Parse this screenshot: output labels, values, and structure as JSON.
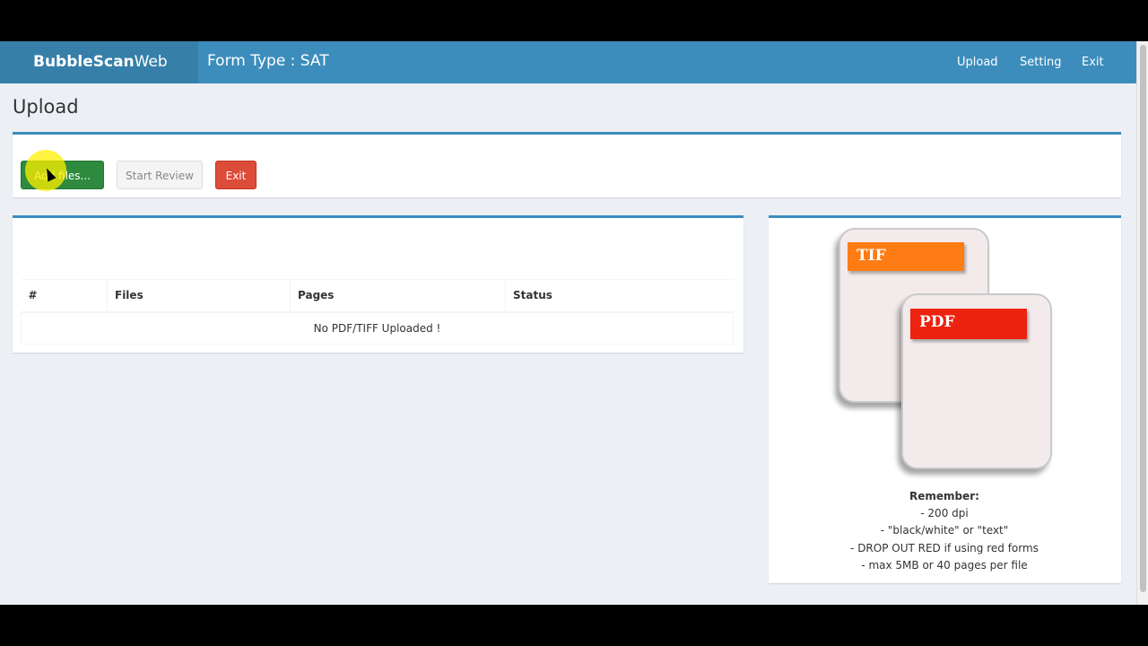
{
  "navbar": {
    "brand_bold": "BubbleScan",
    "brand_light": "Web",
    "form_type": "Form Type : SAT",
    "links": [
      "Upload",
      "Setting",
      "Exit"
    ]
  },
  "page": {
    "title": "Upload"
  },
  "toolbar": {
    "add_files": "Add files...",
    "start_review": "Start Review",
    "exit": "Exit"
  },
  "table": {
    "headers": [
      "#",
      "Files",
      "Pages",
      "Status"
    ],
    "empty_message": "No PDF/TIFF Uploaded !"
  },
  "illustration": {
    "tif_label": "TIF",
    "pdf_label": "PDF",
    "tif_color": "#ff7b13",
    "pdf_color": "#ee2211"
  },
  "remember": {
    "title": "Remember:",
    "items": [
      "- 200 dpi",
      "- \"black/white\" or \"text\"",
      "- DROP OUT RED if using red forms",
      "- max 5MB or 40 pages per file"
    ]
  },
  "colors": {
    "primary": "#3c8dbc",
    "brand_bg": "#367fa9",
    "success": "#2d8a3e",
    "danger": "#dd4b39",
    "background": "#ecf0f5"
  }
}
